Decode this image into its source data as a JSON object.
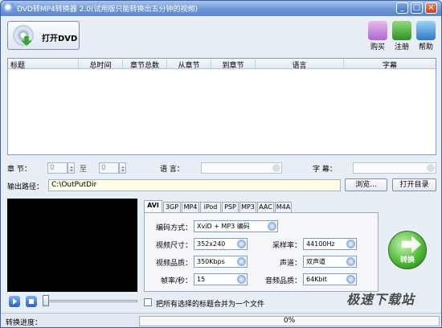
{
  "window": {
    "title": "DVD转MP4转换器 2.0(试用版只能转换出五分钟的视频)",
    "min": "_",
    "max": "□",
    "close": "×"
  },
  "toolbar": {
    "open_dvd": "打开DVD",
    "buy": "购买",
    "register": "注册",
    "help": "帮助"
  },
  "table": {
    "columns": [
      "标题",
      "总时间",
      "章节总数",
      "从章节",
      "到章节",
      "语言",
      "字幕"
    ]
  },
  "chapter": {
    "label": "章    节：",
    "from_value": "0",
    "to_label": "至",
    "to_value": "0",
    "language_label": "语    言：",
    "subtitle_label": "字    幕："
  },
  "output": {
    "label": "输出路径：",
    "path": "C:\\OutPutDir",
    "browse": "浏览...",
    "open_dir": "打开目录"
  },
  "tabs": [
    "AVI",
    "3GP",
    "MP4",
    "iPod",
    "PSP",
    "MP3",
    "AAC",
    "M4A"
  ],
  "settings": {
    "encode_label": "编码方式：",
    "encode_value": "XviD + MP3 编码",
    "size_label": "视频尺寸：",
    "size_value": "352x240",
    "quality_label": "视频品质：",
    "quality_value": "350Kbps",
    "fps_label": "帧率/秒：",
    "fps_value": "15",
    "samplerate_label": "采样率：",
    "samplerate_value": "44100Hz",
    "channel_label": "声道：",
    "channel_value": "双声道",
    "audioq_label": "音频品质：",
    "audioq_value": "64Kbit"
  },
  "convert": {
    "label": "转换"
  },
  "merge": {
    "label": "把所有选择的标题合并为一个文件"
  },
  "status": {
    "label": "转换进度：",
    "progress_text": "0%",
    "progress": 0
  },
  "watermark": "极速下载站",
  "colors": {
    "titlebar": "#6e96d3",
    "accent": "#53b93a",
    "path_bg": "#fffde6"
  }
}
